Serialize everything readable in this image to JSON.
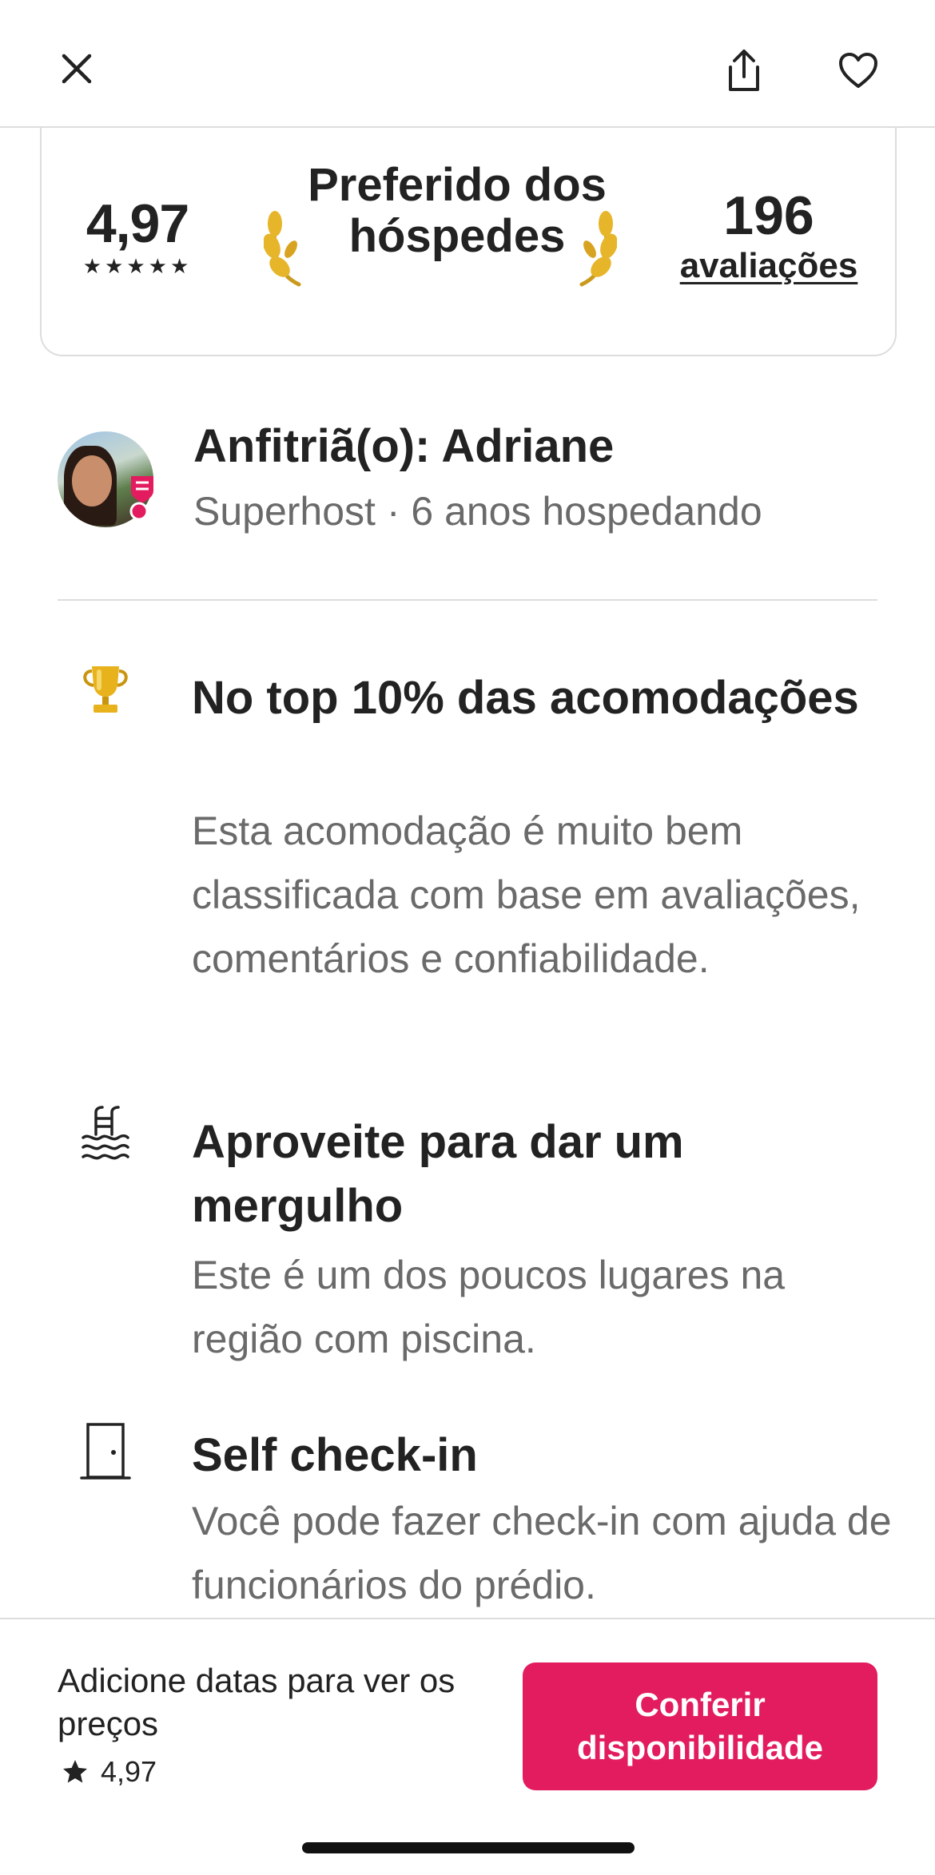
{
  "header": {
    "close_icon": "close-icon",
    "share_icon": "share-icon",
    "favorite_icon": "heart-icon"
  },
  "rating_card": {
    "rating": "4,97",
    "stars": "★★★★★",
    "badge_title": "Preferido dos hóspedes",
    "reviews_count": "196",
    "reviews_label": "avaliações"
  },
  "host": {
    "title": "Anfitriã(o): Adriane",
    "subtitle": "Superhost · 6 anos hospedando"
  },
  "features": [
    {
      "icon": "trophy-icon",
      "title": "No top 10% das acomodações",
      "text": "Esta acomodação é muito bem classificada com base em avaliações, comentários e confiabilidade."
    },
    {
      "icon": "pool-icon",
      "title": "Aproveite para dar um mergulho",
      "text": "Este é um dos poucos lugares na região com piscina."
    },
    {
      "icon": "door-icon",
      "title": "Self check-in",
      "text": "Você pode fazer check-in com ajuda de funcionários do prédio."
    }
  ],
  "bottom_bar": {
    "price_text": "Adicione datas para ver os preços",
    "rating": "4,97",
    "cta_label": "Conferir disponibilidade"
  },
  "colors": {
    "brand": "#e31c5f",
    "text": "#222222",
    "muted": "#6a6a6a",
    "divider": "#dddddd"
  }
}
